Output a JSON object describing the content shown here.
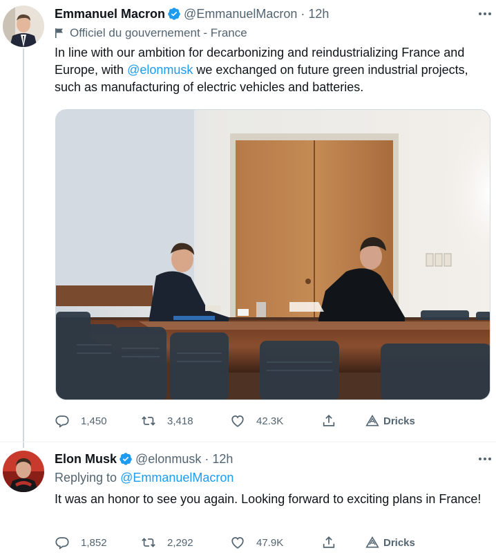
{
  "tweets": [
    {
      "display_name": "Emmanuel Macron",
      "handle": "@EmmanuelMacron",
      "separator": "·",
      "time": "12h",
      "label": "Officiel du gouvernement - France",
      "text_before": "In line with our ambition for decarbonizing and reindustrializing France and Europe, with ",
      "mention": "@elonmusk",
      "text_after": " we exchanged on future green industrial projects, such as manufacturing of electric vehicles and batteries.",
      "icons": {
        "label": "flag-icon",
        "verified": "verified-badge-icon",
        "more": "more-icon"
      },
      "actions": {
        "replies": "1,450",
        "retweets": "3,418",
        "likes": "42.3K",
        "drick": "Dricks"
      }
    },
    {
      "display_name": "Elon Musk",
      "handle": "@elonmusk",
      "separator": "·",
      "time": "12h",
      "replying_prefix": "Replying to ",
      "replying_to": "@EmmanuelMacron",
      "text": "It was an honor to see you again. Looking forward to exciting plans in France!",
      "icons": {
        "verified": "verified-badge-icon",
        "more": "more-icon"
      },
      "actions": {
        "replies": "1,852",
        "retweets": "2,292",
        "likes": "47.9K",
        "drick": "Dricks"
      }
    }
  ],
  "colors": {
    "link": "#1d9bf0",
    "muted": "#536471",
    "text": "#0f1419",
    "verified": "#1d9bf0"
  }
}
